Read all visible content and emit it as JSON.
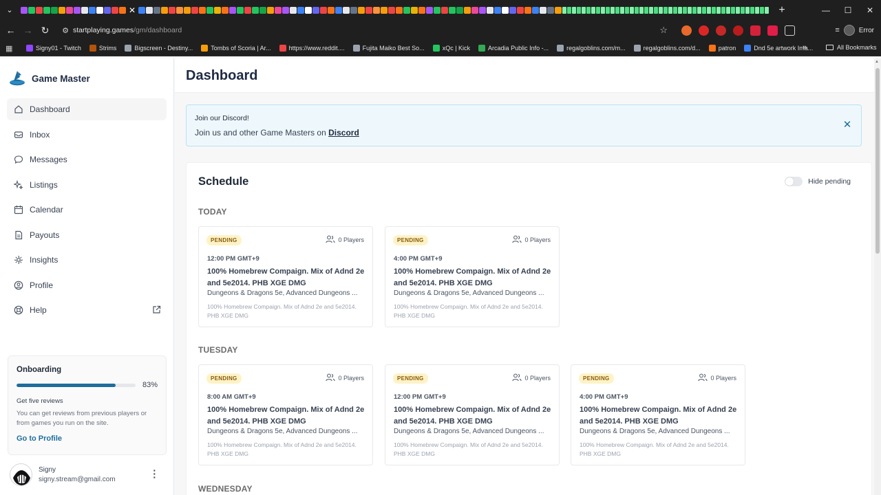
{
  "browser": {
    "url_host": "startplaying.games",
    "url_path": "/gm/dashboard",
    "profile_status": "Error",
    "bookmarks": [
      {
        "label": "Signy01 - Twitch",
        "color": "#9146ff"
      },
      {
        "label": "Strims",
        "color": "#b45309"
      },
      {
        "label": "Bigscreen - Destiny...",
        "color": "#9ca3af"
      },
      {
        "label": "Tombs of Scoria | Ar...",
        "color": "#f59e0b"
      },
      {
        "label": "https://www.reddit....",
        "color": "#ef4444"
      },
      {
        "label": "Fujita Maiko Best So...",
        "color": "#9ca3af"
      },
      {
        "label": "xQc | Kick",
        "color": "#22c55e"
      },
      {
        "label": "Arcadia Public Info -...",
        "color": "#34a853"
      },
      {
        "label": "regalgoblins.com/m...",
        "color": "#9ca3af"
      },
      {
        "label": "regalgoblins.com/d...",
        "color": "#9ca3af"
      },
      {
        "label": "patron",
        "color": "#f97316"
      },
      {
        "label": "Dnd 5e artwork Ima...",
        "color": "#3b82f6"
      }
    ],
    "all_bookmarks": "All Bookmarks"
  },
  "brand": {
    "name": "Game Master"
  },
  "nav": [
    {
      "label": "Dashboard",
      "icon": "home-icon"
    },
    {
      "label": "Inbox",
      "icon": "inbox-icon"
    },
    {
      "label": "Messages",
      "icon": "chat-icon"
    },
    {
      "label": "Listings",
      "icon": "sparkle-icon"
    },
    {
      "label": "Calendar",
      "icon": "calendar-icon"
    },
    {
      "label": "Payouts",
      "icon": "document-icon"
    },
    {
      "label": "Insights",
      "icon": "insights-icon"
    },
    {
      "label": "Profile",
      "icon": "user-icon"
    },
    {
      "label": "Help",
      "icon": "help-icon"
    }
  ],
  "onboarding": {
    "title": "Onboarding",
    "percent_label": "83%",
    "percent": 0.83,
    "task_title": "Get five reviews",
    "task_desc": "You can get reviews from previous players or from games you run on the site.",
    "link": "Go to Profile"
  },
  "user": {
    "name": "Signy",
    "email": "signy.stream@gmail.com"
  },
  "page": {
    "title": "Dashboard"
  },
  "discord": {
    "title": "Join our Discord!",
    "text": "Join us and other Game Masters on",
    "link": "Discord"
  },
  "schedule": {
    "title": "Schedule",
    "toggle_label": "Hide pending",
    "days": [
      {
        "label": "TODAY"
      },
      {
        "label": "TUESDAY"
      },
      {
        "label": "WEDNESDAY"
      }
    ],
    "cards": [
      {
        "badge": "PENDING",
        "players": "0 Players",
        "time": "12:00 PM GMT+9",
        "title": "100% Homebrew Compaign. Mix of Adnd 2e and 5e2014. PHB XGE DMG",
        "sub": "Dungeons & Dragons 5e, Advanced Dungeons ...",
        "desc": "100% Homebrew Compaign. Mix of Adnd 2e and 5e2014. PHB XGE DMG"
      },
      {
        "badge": "PENDING",
        "players": "0 Players",
        "time": "4:00 PM GMT+9",
        "title": "100% Homebrew Compaign. Mix of Adnd 2e and 5e2014. PHB XGE DMG",
        "sub": "Dungeons & Dragons 5e, Advanced Dungeons ...",
        "desc": "100% Homebrew Compaign. Mix of Adnd 2e and 5e2014. PHB XGE DMG"
      },
      {
        "badge": "PENDING",
        "players": "0 Players",
        "time": "8:00 AM GMT+9",
        "title": "100% Homebrew Compaign. Mix of Adnd 2e and 5e2014. PHB XGE DMG",
        "sub": "Dungeons & Dragons 5e, Advanced Dungeons ...",
        "desc": "100% Homebrew Compaign. Mix of Adnd 2e and 5e2014. PHB XGE DMG"
      },
      {
        "badge": "PENDING",
        "players": "0 Players",
        "time": "12:00 PM GMT+9",
        "title": "100% Homebrew Compaign. Mix of Adnd 2e and 5e2014. PHB XGE DMG",
        "sub": "Dungeons & Dragons 5e, Advanced Dungeons ...",
        "desc": "100% Homebrew Compaign. Mix of Adnd 2e and 5e2014. PHB XGE DMG"
      },
      {
        "badge": "PENDING",
        "players": "0 Players",
        "time": "4:00 PM GMT+9",
        "title": "100% Homebrew Compaign. Mix of Adnd 2e and 5e2014. PHB XGE DMG",
        "sub": "Dungeons & Dragons 5e, Advanced Dungeons ...",
        "desc": "100% Homebrew Compaign. Mix of Adnd 2e and 5e2014. PHB XGE DMG"
      }
    ]
  }
}
